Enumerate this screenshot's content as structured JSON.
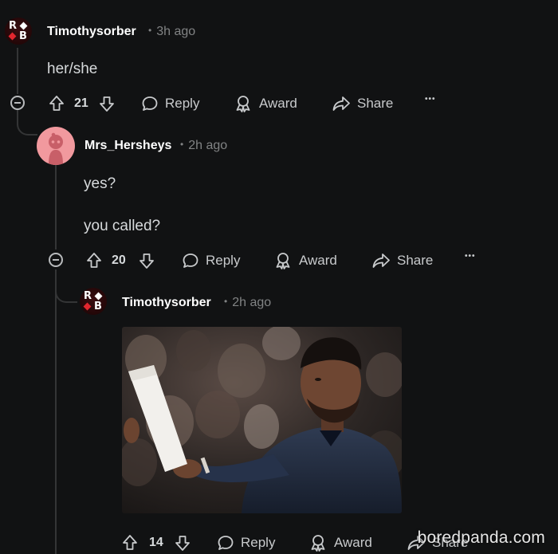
{
  "comments": [
    {
      "username": "Timothysorber",
      "time": "3h ago",
      "avatar": "rb-avatar-icon",
      "lines": [
        "her/she"
      ],
      "votes": "21",
      "actions": {
        "reply": "Reply",
        "award": "Award",
        "share": "Share"
      }
    },
    {
      "username": "Mrs_Hersheys",
      "time": "2h ago",
      "avatar": "snoo-avatar-icon",
      "lines": [
        "yes?",
        "you called?"
      ],
      "votes": "20",
      "actions": {
        "reply": "Reply",
        "award": "Award",
        "share": "Share"
      }
    },
    {
      "username": "Timothysorber",
      "time": "2h ago",
      "avatar": "rb-avatar-icon",
      "image": "man-reading-paper-in-crowd-photo",
      "votes": "14",
      "actions": {
        "reply": "Reply",
        "award": "Award",
        "share": "Share"
      }
    }
  ],
  "more_label": "•••",
  "watermark": "boredpanda.com",
  "colors": {
    "background": "#111213",
    "thread_line": "#343536",
    "meta": "#818384",
    "rb_red": "#e3262e",
    "snoo_pink": "#f1999e"
  }
}
